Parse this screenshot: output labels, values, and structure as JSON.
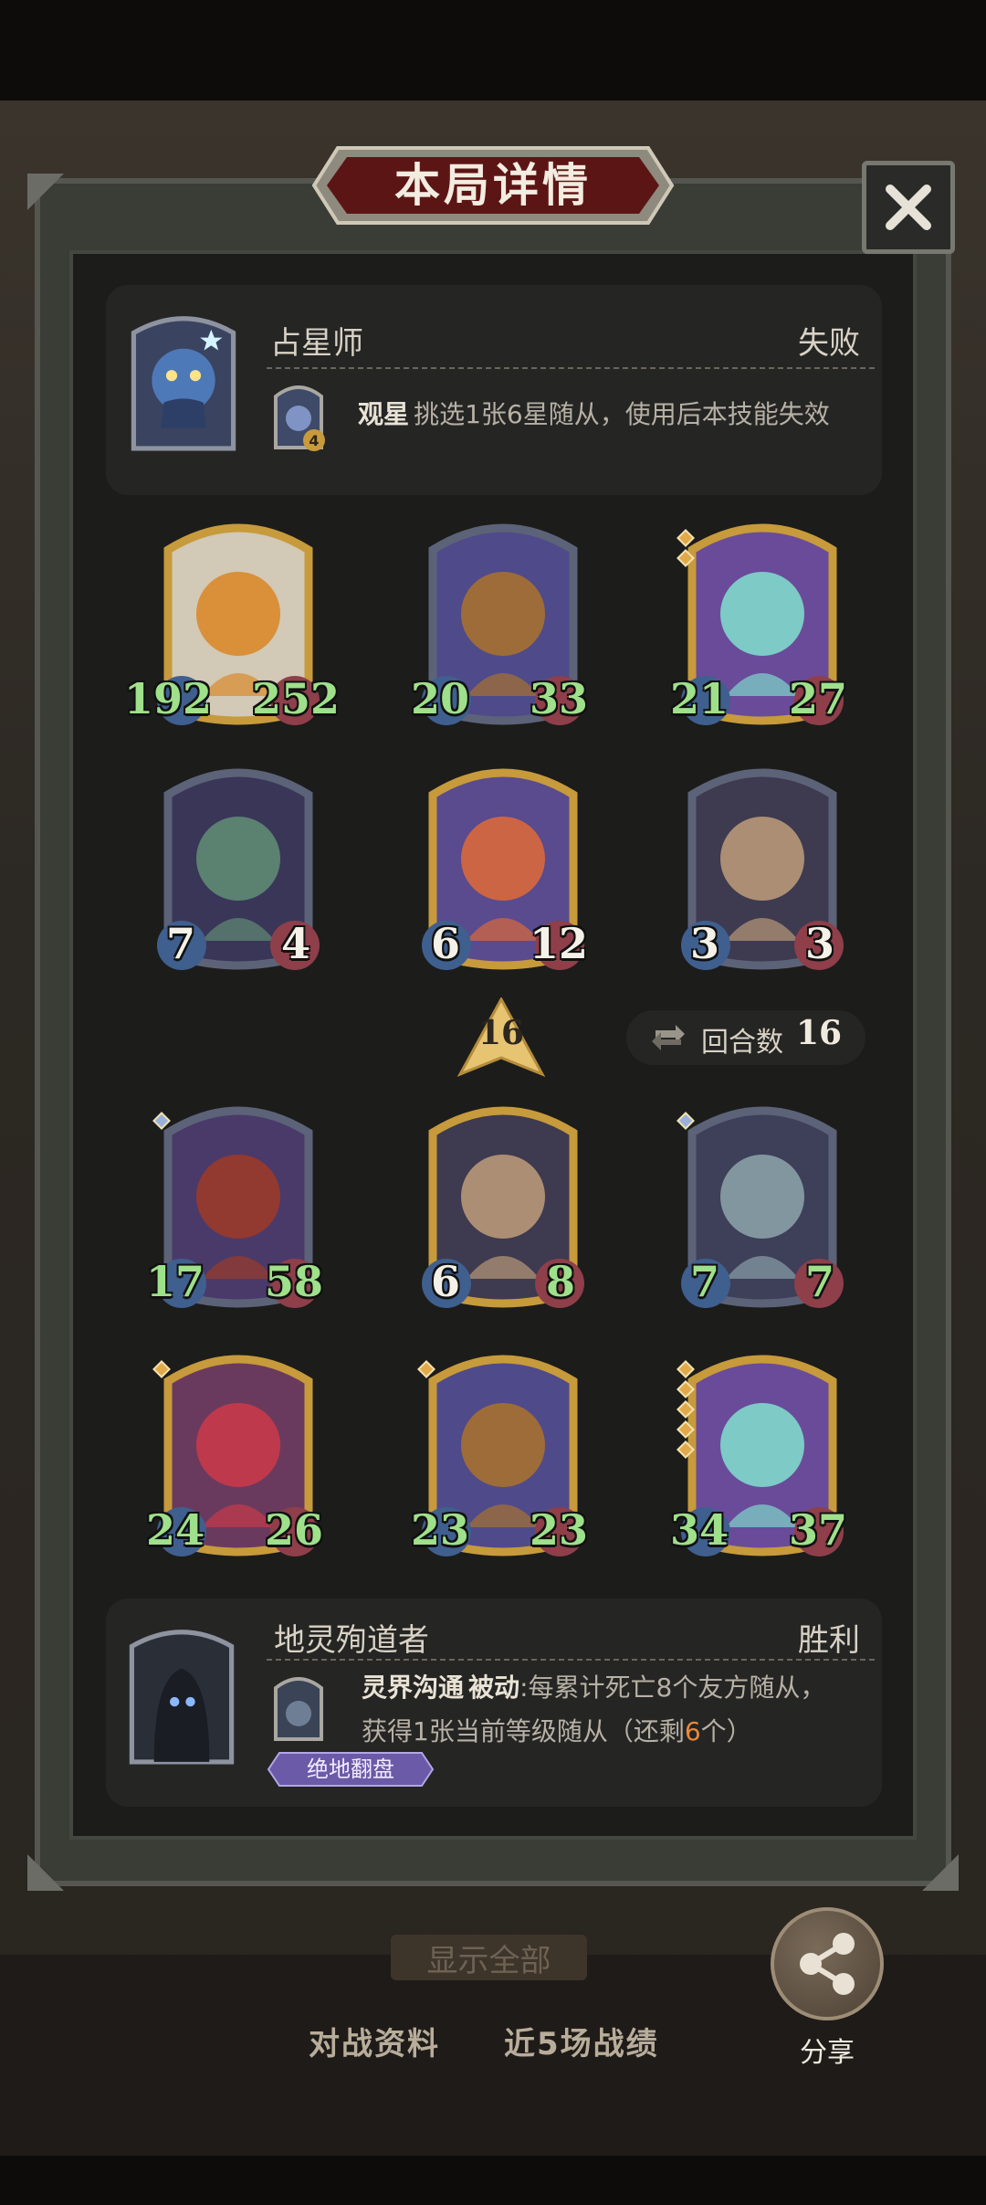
{
  "modal": {
    "title": "本局详情"
  },
  "top_player": {
    "name": "占星师",
    "result": "失败",
    "hero_level": "4",
    "skill": {
      "name": "观星",
      "description": "挑选1张6星随从，使用后本技能失效"
    }
  },
  "top_board": [
    {
      "name": "pumpkin-mummy",
      "attack": "192",
      "health": "252",
      "attack_buffed": true,
      "health_buffed": true,
      "frame": "gold",
      "stars": 0
    },
    {
      "name": "pumpkin-knight",
      "attack": "20",
      "health": "33",
      "attack_buffed": true,
      "health_buffed": true,
      "frame": "silver",
      "stars": 0
    },
    {
      "name": "spirit-ogre",
      "attack": "21",
      "health": "27",
      "attack_buffed": true,
      "health_buffed": true,
      "frame": "gold",
      "stars": 2
    },
    {
      "name": "horned-elf",
      "attack": "7",
      "health": "4",
      "attack_buffed": false,
      "health_buffed": false,
      "frame": "silver",
      "stars": 0
    },
    {
      "name": "singing-siren",
      "attack": "6",
      "health": "12",
      "attack_buffed": false,
      "health_buffed": false,
      "frame": "gold",
      "stars": 0
    },
    {
      "name": "rocket-scrap",
      "attack": "3",
      "health": "3",
      "attack_buffed": false,
      "health_buffed": false,
      "frame": "silver",
      "stars": 0
    }
  ],
  "turn_marker": "16",
  "round_counter": {
    "label": "回合数",
    "value": "16"
  },
  "bottom_board": [
    {
      "name": "hooded-assassin",
      "attack": "17",
      "health": "58",
      "attack_buffed": true,
      "health_buffed": true,
      "frame": "silver",
      "stars": 1
    },
    {
      "name": "rocket-scrap",
      "attack": "6",
      "health": "8",
      "attack_buffed": false,
      "health_buffed": true,
      "frame": "gold",
      "stars": 0
    },
    {
      "name": "robot-skull",
      "attack": "7",
      "health": "7",
      "attack_buffed": true,
      "health_buffed": true,
      "frame": "silver",
      "stars": 1
    },
    {
      "name": "jester-clown",
      "attack": "24",
      "health": "26",
      "attack_buffed": true,
      "health_buffed": true,
      "frame": "gold",
      "stars": 1
    },
    {
      "name": "pumpkin-knight",
      "attack": "23",
      "health": "23",
      "attack_buffed": true,
      "health_buffed": true,
      "frame": "gold",
      "stars": 1
    },
    {
      "name": "spirit-ogre",
      "attack": "34",
      "health": "37",
      "attack_buffed": true,
      "health_buffed": true,
      "frame": "gold",
      "stars": 5
    }
  ],
  "bottom_player": {
    "name": "地灵殉道者",
    "result": "胜利",
    "skill": {
      "name": "灵界沟通",
      "passive_label": "被动",
      "desc_part1": ":每累计死亡8个友方随从，",
      "desc_part2": "获得1张当前等级随从（还剩",
      "remaining": "6",
      "desc_part3": "个）"
    },
    "badge": "绝地翻盘"
  },
  "footer": {
    "show_all": "显示全部",
    "tab_battle_info": "对战资料",
    "tab_recent": "近5场战绩",
    "share": "分享"
  },
  "colors": {
    "buffed_stat": "#9fe08a",
    "normal_stat": "#f4f1e8",
    "gold_frame": "#c79a3b",
    "silver_frame": "#5c6378",
    "highlight": "#e8893b"
  }
}
